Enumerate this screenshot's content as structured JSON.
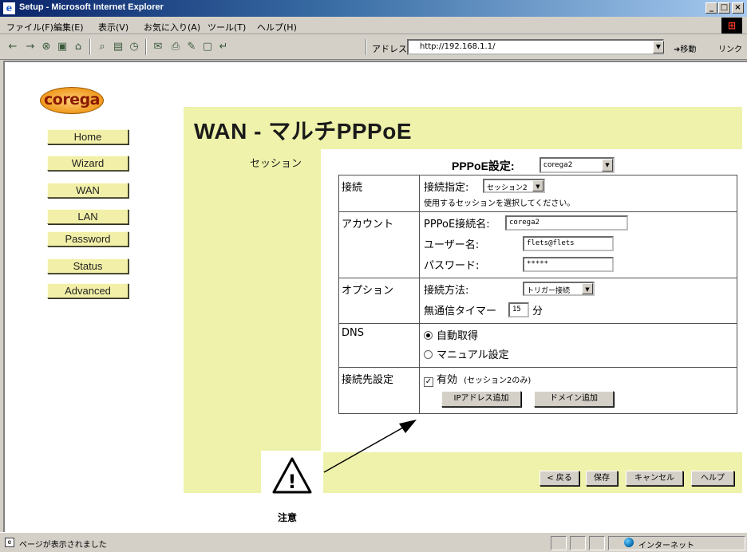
{
  "window": {
    "title": "Setup - Microsoft Internet Explorer",
    "controls": {
      "minimize": "_",
      "maximize": "□",
      "close": "×"
    }
  },
  "menubar": [
    "ファイル(F)",
    "編集(E)",
    "表示(V)",
    "お気に入り(A)",
    "ツール(T)",
    "ヘルプ(H)"
  ],
  "toolbar": {
    "address_label": "アドレス(D)",
    "address_value": "http://192.168.1.1/",
    "go_label": "移動",
    "links_label": "リンク"
  },
  "logo": "corega",
  "nav": [
    "Home",
    "Wizard",
    "WAN",
    "LAN",
    "Password",
    "Status",
    "Advanced"
  ],
  "page": {
    "title": "WAN - マルチPPPoE",
    "section_label": "セッション",
    "pppoe_label": "PPPoE設定:",
    "pppoe_select": "corega2"
  },
  "settings": {
    "connection": {
      "header": "接続",
      "label": "接続指定:",
      "select": "セッション2",
      "hint": "使用するセッションを選択してください。"
    },
    "account": {
      "header": "アカウント",
      "name_label": "PPPoE接続名:",
      "name_value": "corega2",
      "user_label": "ユーザー名:",
      "user_value": "flets@flets",
      "password_label": "パスワード:",
      "password_value": "*****"
    },
    "options": {
      "header": "オプション",
      "method_label": "接続方法:",
      "method_select": "トリガー接続",
      "timer_label": "無通信タイマー",
      "timer_value": "15",
      "timer_unit": "分"
    },
    "dns": {
      "header": "DNS",
      "auto": "自動取得",
      "manual": "マニュアル設定",
      "selected": "auto"
    },
    "destination": {
      "header": "接続先設定",
      "checkbox_label": "有効",
      "checkbox_note": "(セッション2のみ)",
      "checked": true,
      "add_ip_button": "IPアドレス追加",
      "add_domain_button": "ドメイン追加"
    }
  },
  "footer_buttons": {
    "back": "< 戻る",
    "save": "保存",
    "cancel": "キャンセル",
    "help": "ヘルプ"
  },
  "warning": {
    "symbol": "!",
    "label": "注意"
  },
  "statusbar": {
    "status_text": "ページが表示されました",
    "zone": "インターネット"
  },
  "colors": {
    "panel": "#eef2aa",
    "nav_button": "#f2f0a8",
    "title_bar": "#0a246a",
    "logo": "#f09a1e"
  }
}
